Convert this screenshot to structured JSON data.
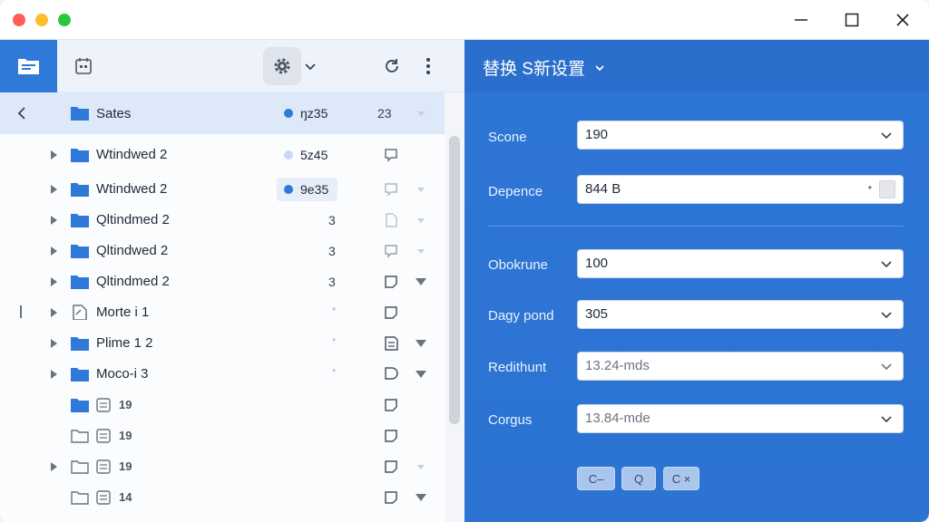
{
  "window": {
    "traffic_lights": [
      "close",
      "minimize",
      "zoom"
    ],
    "controls": [
      "minimize",
      "maximize",
      "close"
    ]
  },
  "toolbar": {
    "icons": [
      "folder-app-icon",
      "calendar-icon",
      "gear-icon",
      "chevron-down-icon",
      "refresh-icon",
      "more-vertical-icon"
    ]
  },
  "tree": {
    "header": {
      "name": "Sates",
      "status": "ŋz35",
      "count": "23"
    },
    "rows": [
      {
        "name": "Wtindwed 2",
        "status": "5z45",
        "dot": "light"
      },
      {
        "name": "Wtindwed 2",
        "status": "9e35",
        "dot": "blue"
      },
      {
        "name": "Qltindmed 2",
        "count": "3"
      },
      {
        "name": "Qltindwed 2",
        "count": "3"
      },
      {
        "name": "Qltindmed 2",
        "count": "3"
      },
      {
        "name": "Morte i 1"
      },
      {
        "name": "Plime 1 2"
      },
      {
        "name": "Moco-i 3"
      },
      {
        "name": "19"
      },
      {
        "name": "19"
      },
      {
        "name": "19"
      },
      {
        "name": "14"
      }
    ]
  },
  "settings": {
    "title": "替换 S新设置",
    "fields": [
      {
        "label": "Scone",
        "value": "190"
      },
      {
        "label": "Depence",
        "value": "844 B"
      },
      {
        "label": "Obokrune",
        "value": "100"
      },
      {
        "label": "Dagy pond",
        "value": "305"
      },
      {
        "label": "Redithunt",
        "value": "13.24-mds"
      },
      {
        "label": "Corgus",
        "value": "13.84-mde"
      }
    ],
    "buttons": [
      "C–",
      "Q",
      "C ×"
    ]
  },
  "colors": {
    "accent": "#2f7ad9",
    "panel": "#2e76d6",
    "selected_row": "#dde9f8"
  }
}
